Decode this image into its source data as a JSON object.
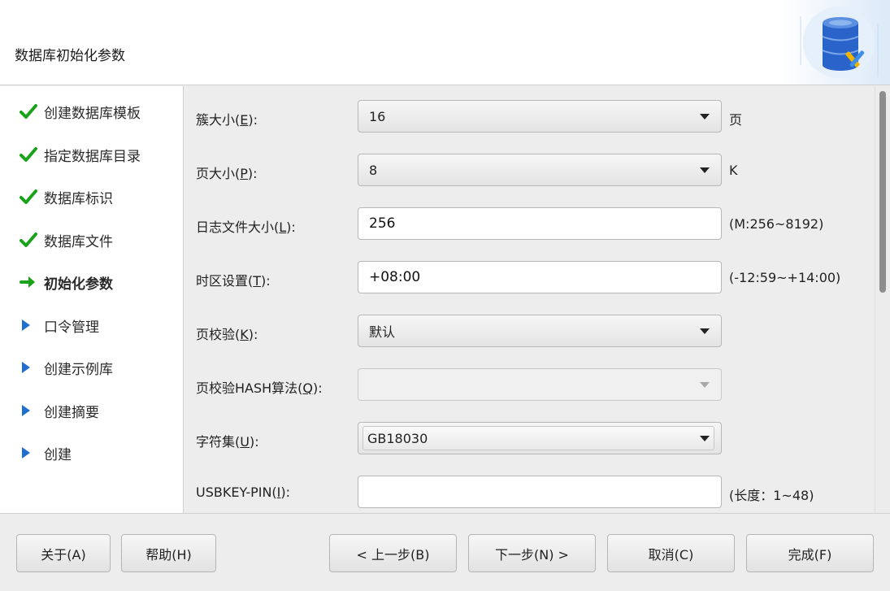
{
  "header": {
    "title": "数据库初始化参数",
    "graphic": "database-tools-icon"
  },
  "sidebar": {
    "steps": [
      {
        "label": "创建数据库模板",
        "status": "done"
      },
      {
        "label": "指定数据库目录",
        "status": "done"
      },
      {
        "label": "数据库标识",
        "status": "done"
      },
      {
        "label": "数据库文件",
        "status": "done"
      },
      {
        "label": "初始化参数",
        "status": "current"
      },
      {
        "label": "口令管理",
        "status": "pending"
      },
      {
        "label": "创建示例库",
        "status": "pending"
      },
      {
        "label": "创建摘要",
        "status": "pending"
      },
      {
        "label": "创建",
        "status": "pending"
      }
    ]
  },
  "form": {
    "extent_size": {
      "label": "簇大小(",
      "mnemonic": "E",
      "label_end": "):",
      "value": "16",
      "suffix": "页"
    },
    "page_size": {
      "label": "页大小(",
      "mnemonic": "P",
      "label_end": "):",
      "value": "8",
      "suffix": "K"
    },
    "log_size": {
      "label": "日志文件大小(",
      "mnemonic": "L",
      "label_end": "):",
      "value": "256",
      "suffix": "(M:256~8192)"
    },
    "timezone": {
      "label": "时区设置(",
      "mnemonic": "T",
      "label_end": "):",
      "value": "+08:00",
      "suffix": "(-12:59~+14:00)"
    },
    "page_check": {
      "label": "页校验(",
      "mnemonic": "K",
      "label_end": "):",
      "value": "默认"
    },
    "page_check_hash": {
      "label": "页校验HASH算法(",
      "mnemonic": "Q",
      "label_end": "):",
      "value": ""
    },
    "charset": {
      "label": "字符集(",
      "mnemonic": "U",
      "label_end": "):",
      "value": "GB18030"
    },
    "usbkey_pin": {
      "label": "USBKEY-PIN(",
      "mnemonic": "I",
      "label_end": "):",
      "value": "",
      "suffix": "(长度：1~48)"
    }
  },
  "footer": {
    "about": "关于(A)",
    "help": "帮助(H)",
    "back": "< 上一步(B)",
    "next": "下一步(N) >",
    "cancel": "取消(C)",
    "finish": "完成(F)"
  },
  "colors": {
    "check": "#1aa21a",
    "arrow_current": "#1aa21a",
    "arrow_pending": "#1f6fd1",
    "db_blue": "#2a63c9"
  }
}
